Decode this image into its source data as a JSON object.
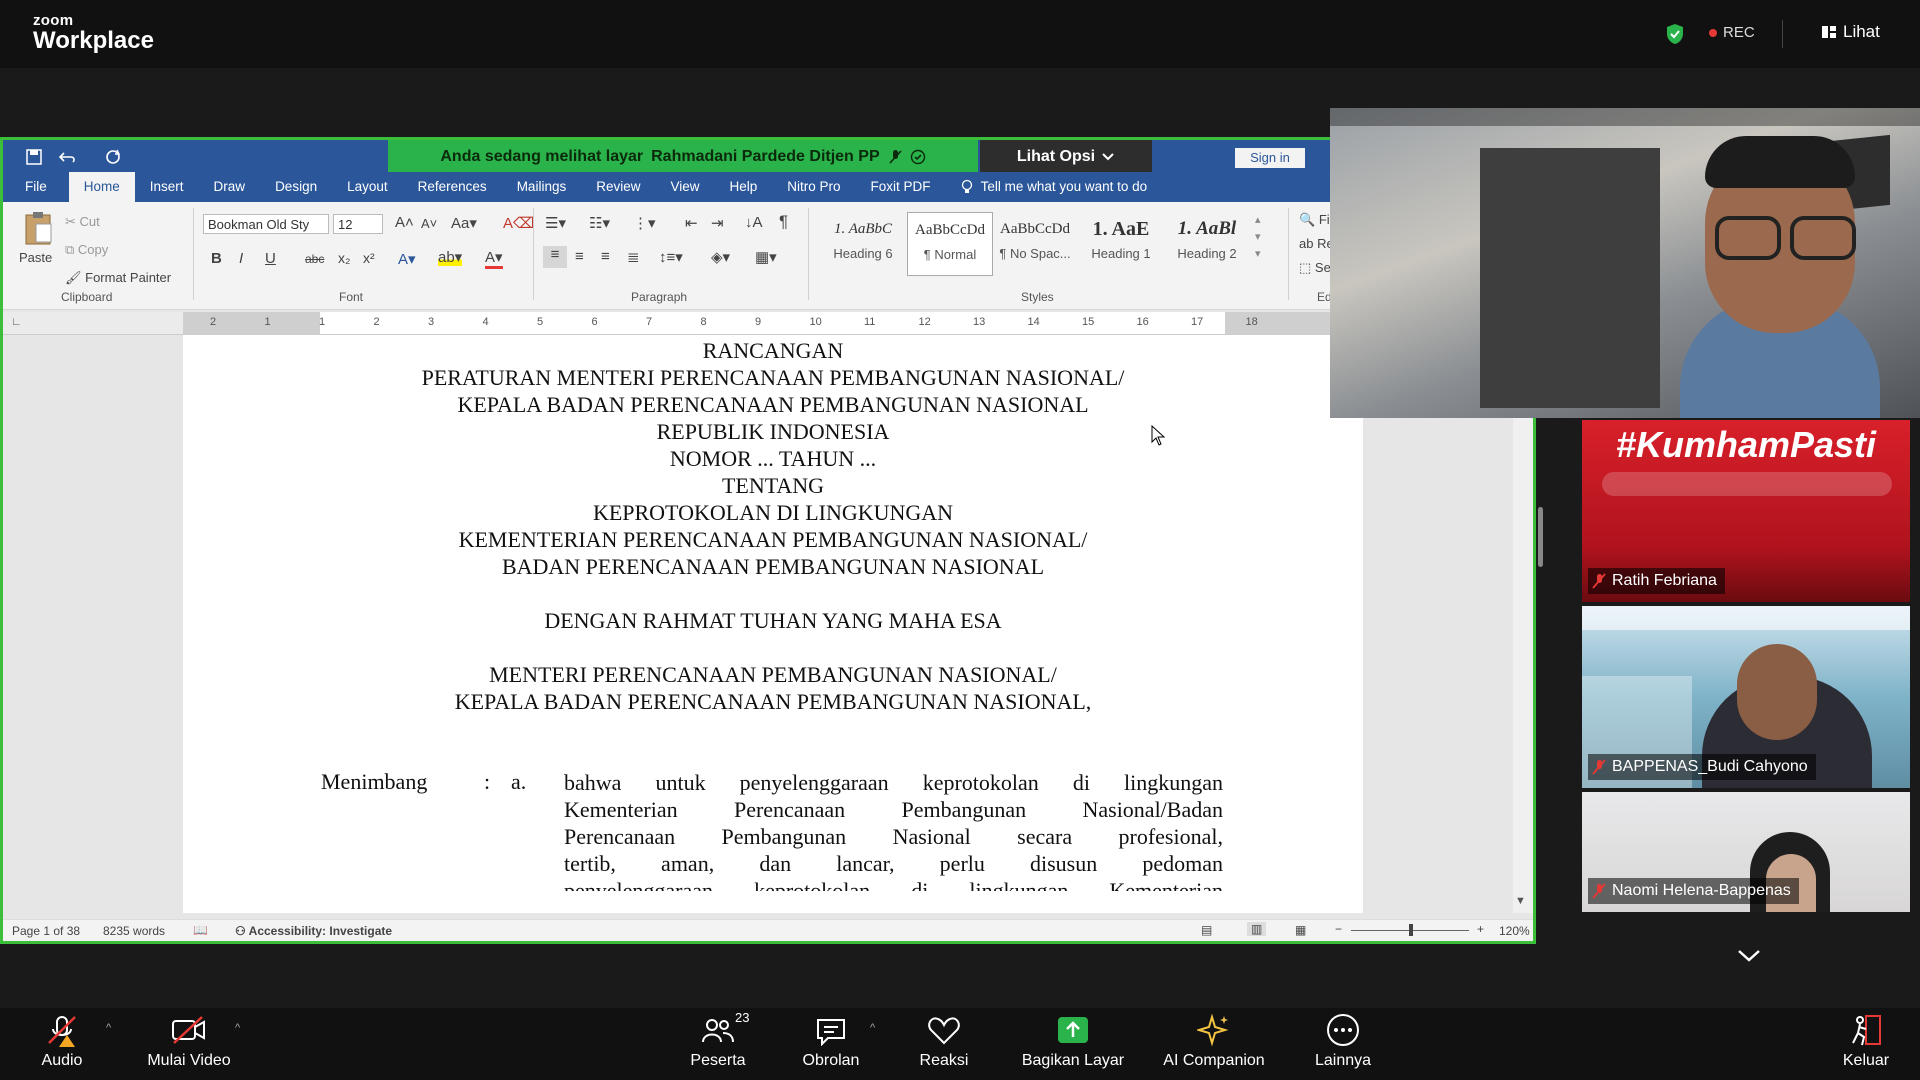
{
  "zoom": {
    "logo_small": "zoom",
    "logo_big": "Workplace",
    "rec_label": "REC",
    "view_label": "Lihat",
    "banner_text": "Anda sedang melihat layar",
    "presenter_name": "Rahmadani Pardede Ditjen PP",
    "options_label": "Lihat Opsi"
  },
  "word": {
    "sign_in": "Sign in",
    "menu": [
      "File",
      "Home",
      "Insert",
      "Draw",
      "Design",
      "Layout",
      "References",
      "Mailings",
      "Review",
      "View",
      "Help",
      "Nitro Pro",
      "Foxit PDF"
    ],
    "tell_me": "Tell me what you want to do",
    "clipboard": {
      "paste": "Paste",
      "cut": "Cut",
      "copy": "Copy",
      "format_painter": "Format Painter",
      "label": "Clipboard"
    },
    "font": {
      "name": "Bookman Old Sty",
      "size": "12",
      "label": "Font"
    },
    "paragraph_label": "Paragraph",
    "styles_label": "Styles",
    "editing_short": "Edi",
    "styles": [
      {
        "preview": "1. AaBbC",
        "name": "Heading 6"
      },
      {
        "preview": "AaBbCcDd",
        "name": "¶ Normal"
      },
      {
        "preview": "AaBbCcDd",
        "name": "¶ No Spac..."
      },
      {
        "preview": "1. AaE",
        "name": "Heading 1"
      },
      {
        "preview": "1. AaBl",
        "name": "Heading 2"
      }
    ],
    "editing_items": [
      "Fi",
      "Re",
      "Se"
    ],
    "ruler_numbers": [
      "2",
      "1",
      "1",
      "2",
      "3",
      "4",
      "5",
      "6",
      "7",
      "8",
      "9",
      "10",
      "11",
      "12",
      "13",
      "14",
      "15",
      "16",
      "17",
      "18"
    ],
    "status": {
      "page": "Page 1 of 38",
      "words": "8235 words",
      "accessibility": "Accessibility: Investigate",
      "zoom": "120%"
    }
  },
  "document": {
    "lines": [
      "RANCANGAN",
      "PERATURAN MENTERI PERENCANAAN PEMBANGUNAN NASIONAL/",
      "KEPALA BADAN PERENCANAAN PEMBANGUNAN NASIONAL",
      "REPUBLIK INDONESIA",
      "NOMOR ... TAHUN ...",
      "TENTANG",
      "KEPROTOKOLAN DI LINGKUNGAN",
      "KEMENTERIAN PERENCANAAN PEMBANGUNAN NASIONAL/",
      "BADAN PERENCANAAN PEMBANGUNAN NASIONAL",
      "DENGAN RAHMAT TUHAN YANG MAHA ESA",
      "MENTERI PERENCANAAN PEMBANGUNAN NASIONAL/",
      "KEPALA BADAN PERENCANAAN PEMBANGUNAN NASIONAL,"
    ],
    "menimbang_label": "Menimbang",
    "colon": ":",
    "item_a": "a.",
    "body": [
      "bahwa untuk penyelenggaraan keprotokolan di lingkungan",
      "Kementerian Perencanaan Pembangunan Nasional/Badan",
      "Perencanaan Pembangunan Nasional secara profesional,",
      "tertib, aman, dan lancar, perlu disusun pedoman",
      "penyelenggaraan keprotokolan di lingkungan Kementerian"
    ]
  },
  "participants": [
    {
      "name": "Ratih Febriana",
      "overlay": "#KumhamPasti"
    },
    {
      "name": "BAPPENAS_Budi Cahyono"
    },
    {
      "name": "Naomi Helena-Bappenas"
    }
  ],
  "toolbar": {
    "audio": "Audio",
    "video": "Mulai Video",
    "participants": "Peserta",
    "participants_count": "23",
    "chat": "Obrolan",
    "reactions": "Reaksi",
    "share": "Bagikan Layar",
    "ai": "AI Companion",
    "more": "Lainnya",
    "leave": "Keluar"
  },
  "colors": {
    "word_blue": "#2b579a",
    "share_green": "#2ab34a",
    "rec_red": "#e53935"
  }
}
